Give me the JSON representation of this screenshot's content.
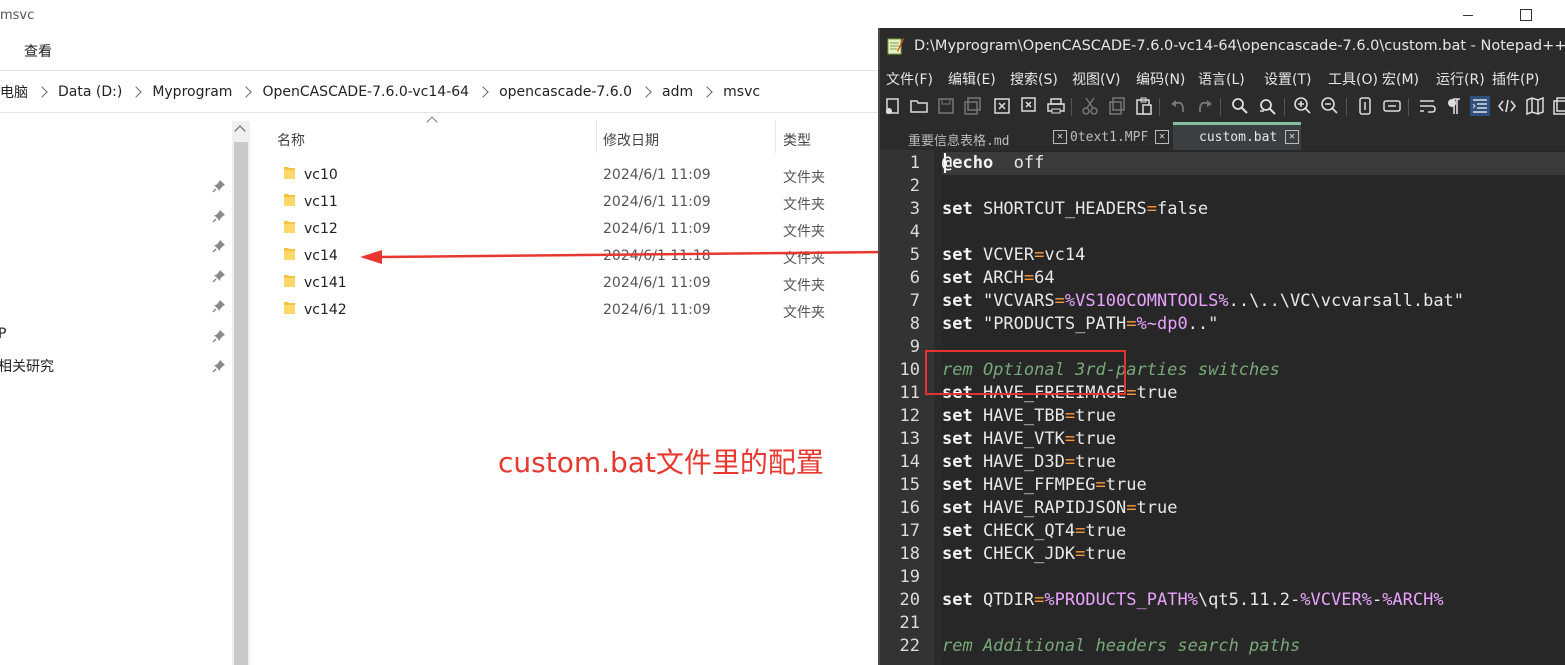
{
  "explorer": {
    "window_title": "msvc",
    "ribbon": {
      "view_tab": "查看"
    },
    "breadcrumb": [
      "此电脑",
      "Data (D:)",
      "Myprogram",
      "OpenCASCADE-7.6.0-vc14-64",
      "opencascade-7.6.0",
      "adm",
      "msvc"
    ],
    "nav_items": [
      {
        "label": "",
        "pinned": true
      },
      {
        "label": "",
        "pinned": true
      },
      {
        "label": "",
        "pinned": true
      },
      {
        "label": "",
        "pinned": true
      },
      {
        "label": "",
        "pinned": true
      },
      {
        "label": "P",
        "pinned": true
      },
      {
        "label": "相关研究",
        "pinned": true
      }
    ],
    "columns": {
      "name": "名称",
      "date": "修改日期",
      "type": "类型"
    },
    "files": [
      {
        "name": "vc10",
        "date": "2024/6/1 11:09",
        "type": "文件夹"
      },
      {
        "name": "vc11",
        "date": "2024/6/1 11:09",
        "type": "文件夹"
      },
      {
        "name": "vc12",
        "date": "2024/6/1 11:09",
        "type": "文件夹"
      },
      {
        "name": "vc14",
        "date": "2024/6/1 11:18",
        "type": "文件夹"
      },
      {
        "name": "vc141",
        "date": "2024/6/1 11:09",
        "type": "文件夹"
      },
      {
        "name": "vc142",
        "date": "2024/6/1 11:09",
        "type": "文件夹"
      }
    ],
    "folder_color": "#f5c342"
  },
  "annotation": {
    "text": "custom.bat文件里的配置",
    "color": "#e8372f"
  },
  "notepad": {
    "title": "D:\\Myprogram\\OpenCASCADE-7.6.0-vc14-64\\opencascade-7.6.0\\custom.bat - Notepad++",
    "menu": [
      "文件(F)",
      "编辑(E)",
      "搜索(S)",
      "视图(V)",
      "编码(N)",
      "语言(L)",
      "设置(T)",
      "工具(O)",
      "宏(M)",
      "运行(R)",
      "插件(P)"
    ],
    "tabs": [
      {
        "label": "重要信息表格.md"
      },
      {
        "label": "0text1.MPF"
      },
      {
        "label": "custom.bat",
        "active": true
      }
    ],
    "lines": [
      {
        "n": "1",
        "parts": [
          [
            "kw",
            "@echo"
          ],
          [
            "",
            "  off"
          ]
        ]
      },
      {
        "n": "2",
        "parts": []
      },
      {
        "n": "3",
        "parts": [
          [
            "kw",
            "set"
          ],
          [
            "",
            " SHORTCUT_HEADERS"
          ],
          [
            "op",
            "="
          ],
          [
            "",
            "false"
          ]
        ]
      },
      {
        "n": "4",
        "parts": []
      },
      {
        "n": "5",
        "parts": [
          [
            "kw",
            "set"
          ],
          [
            "",
            " VCVER"
          ],
          [
            "op",
            "="
          ],
          [
            "",
            "vc14"
          ]
        ]
      },
      {
        "n": "6",
        "parts": [
          [
            "kw",
            "set"
          ],
          [
            "",
            " ARCH"
          ],
          [
            "op",
            "="
          ],
          [
            "",
            "64"
          ]
        ]
      },
      {
        "n": "7",
        "parts": [
          [
            "kw",
            "set"
          ],
          [
            "",
            " \"VCVARS"
          ],
          [
            "op",
            "="
          ],
          [
            "var",
            "%VS100COMNTOOLS%"
          ],
          [
            "",
            "..\\..\\VC\\vcvarsall.bat\""
          ]
        ]
      },
      {
        "n": "8",
        "parts": [
          [
            "kw",
            "set"
          ],
          [
            "",
            " \"PRODUCTS_PATH"
          ],
          [
            "op",
            "="
          ],
          [
            "var",
            "%~dp0"
          ],
          [
            "",
            "..\""
          ]
        ]
      },
      {
        "n": "9",
        "parts": []
      },
      {
        "n": "10",
        "parts": [
          [
            "cmt",
            "rem Optional 3rd-parties switches"
          ]
        ]
      },
      {
        "n": "11",
        "parts": [
          [
            "kw",
            "set"
          ],
          [
            "",
            " HAVE_FREEIMAGE"
          ],
          [
            "op",
            "="
          ],
          [
            "",
            "true"
          ]
        ]
      },
      {
        "n": "12",
        "parts": [
          [
            "kw",
            "set"
          ],
          [
            "",
            " HAVE_TBB"
          ],
          [
            "op",
            "="
          ],
          [
            "",
            "true"
          ]
        ]
      },
      {
        "n": "13",
        "parts": [
          [
            "kw",
            "set"
          ],
          [
            "",
            " HAVE_VTK"
          ],
          [
            "op",
            "="
          ],
          [
            "",
            "true"
          ]
        ]
      },
      {
        "n": "14",
        "parts": [
          [
            "kw",
            "set"
          ],
          [
            "",
            " HAVE_D3D"
          ],
          [
            "op",
            "="
          ],
          [
            "",
            "true"
          ]
        ]
      },
      {
        "n": "15",
        "parts": [
          [
            "kw",
            "set"
          ],
          [
            "",
            " HAVE_FFMPEG"
          ],
          [
            "op",
            "="
          ],
          [
            "",
            "true"
          ]
        ]
      },
      {
        "n": "16",
        "parts": [
          [
            "kw",
            "set"
          ],
          [
            "",
            " HAVE_RAPIDJSON"
          ],
          [
            "op",
            "="
          ],
          [
            "",
            "true"
          ]
        ]
      },
      {
        "n": "17",
        "parts": [
          [
            "kw",
            "set"
          ],
          [
            "",
            " CHECK_QT4"
          ],
          [
            "op",
            "="
          ],
          [
            "",
            "true"
          ]
        ]
      },
      {
        "n": "18",
        "parts": [
          [
            "kw",
            "set"
          ],
          [
            "",
            " CHECK_JDK"
          ],
          [
            "op",
            "="
          ],
          [
            "",
            "true"
          ]
        ]
      },
      {
        "n": "19",
        "parts": []
      },
      {
        "n": "20",
        "parts": [
          [
            "kw",
            "set"
          ],
          [
            "",
            " QTDIR"
          ],
          [
            "op",
            "="
          ],
          [
            "var",
            "%PRODUCTS_PATH%"
          ],
          [
            "",
            "\\qt5.11.2-"
          ],
          [
            "var",
            "%VCVER%"
          ],
          [
            "",
            "-"
          ],
          [
            "var",
            "%ARCH%"
          ]
        ]
      },
      {
        "n": "21",
        "parts": []
      },
      {
        "n": "22",
        "parts": [
          [
            "cmt",
            "rem Additional headers search paths"
          ]
        ]
      }
    ],
    "highlight_color": "#e33333"
  }
}
